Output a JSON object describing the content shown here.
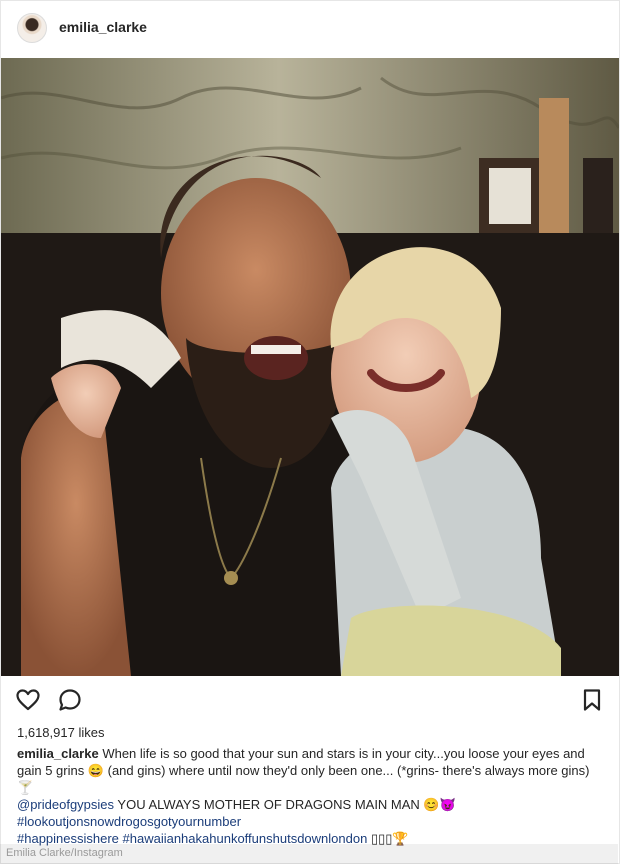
{
  "header": {
    "username": "emilia_clarke"
  },
  "post": {
    "image_alt": "photo of two smiling people sitting together",
    "likes": "1,618,917 likes",
    "caption": {
      "username": "emilia_clarke",
      "text": "When life is so good that your sun and stars is in your city...you loose your eyes and gain 5 grins 😄 (and gins) where until now they'd only been one... (*grins- there's always more gins) 🍸",
      "mention": "@prideofgypsies",
      "mention_text": "YOU ALWAYS MOTHER OF DRAGONS MAIN MAN 😊😈",
      "hashtag1": "#lookoutjonsnowdrogosgotyournumber",
      "hashtag2": "#happinessishere #hawaiianhakahunkoffunshutsdownlondon",
      "hashtag2_suffix": "▯▯▯🏆"
    }
  },
  "actions": {
    "like_icon": "heart-icon",
    "comment_icon": "comment-icon",
    "save_icon": "bookmark-icon"
  },
  "credit": {
    "text": "Emilia Clarke/Instagram"
  },
  "colors": {
    "text": "#262626",
    "link": "#1b3d7a",
    "border": "#e6e6e6"
  }
}
